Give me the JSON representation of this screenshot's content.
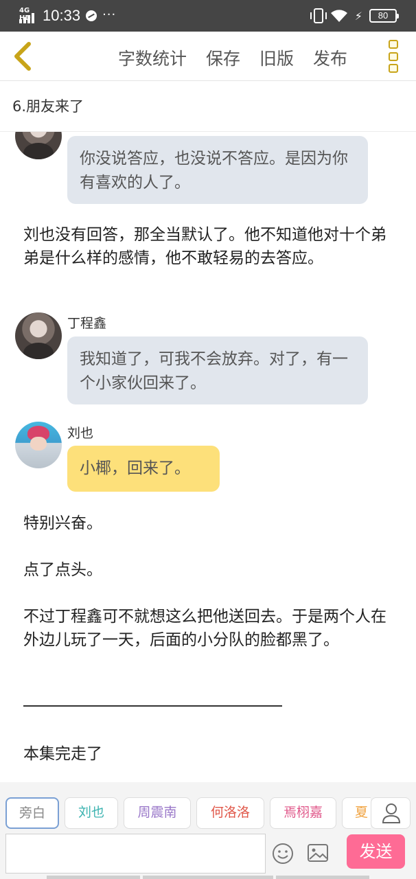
{
  "status_bar": {
    "network": "4G HD",
    "time": "10:33",
    "battery": "80",
    "more": "···"
  },
  "toolbar": {
    "actions": [
      "字数统计",
      "保存",
      "旧版",
      "发布"
    ]
  },
  "chapter_title": "6.朋友来了",
  "messages": {
    "m1_bubble": "你没说答应，也没说不答应。是因为你有喜欢的人了。",
    "p1": "刘也没有回答，那全当默认了。他不知道他对十个弟弟是什么样的感情，他不敢轻易的去答应。",
    "m2_name": "丁程鑫",
    "m2_bubble": "我知道了，可我不会放弃。对了，有一个小家伙回来了。",
    "m3_name": "刘也",
    "m3_bubble": "小椰，回来了。",
    "p2": "特别兴奋。",
    "p3": "点了点头。",
    "p4": "不过丁程鑫可不就想这么把他送回去。于是两个人在外边儿玩了一天，后面的小分队的脸都黑了。",
    "p5": "本集完走了"
  },
  "roles": [
    {
      "label": "旁白",
      "color": "#888888"
    },
    {
      "label": "刘也",
      "color": "#3bb3b0"
    },
    {
      "label": "周震南",
      "color": "#9a78c9"
    },
    {
      "label": "何洛洛",
      "color": "#e0584a"
    },
    {
      "label": "焉栩嘉",
      "color": "#e0588a"
    },
    {
      "label": "夏",
      "color": "#f0a340"
    }
  ],
  "composer": {
    "input_value": "",
    "send_label": "发送"
  },
  "colors": {
    "accent_yellow": "#fde07a",
    "bubble_gray": "#e1e6ed",
    "send_pink": "#fe6b95"
  }
}
